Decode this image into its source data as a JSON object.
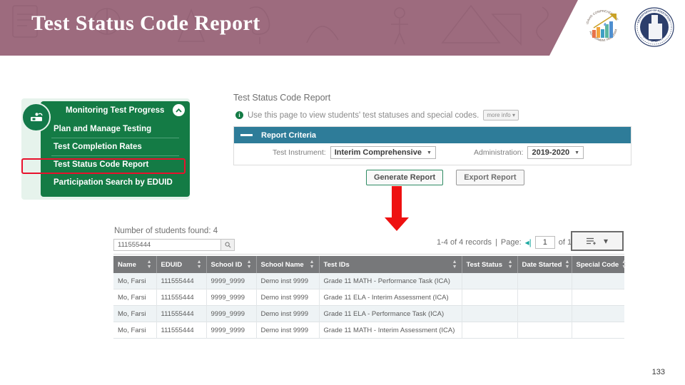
{
  "banner": {
    "title": "Test Status Code Report",
    "color": "#9d6b7e",
    "logos": [
      {
        "name": "idaho-comprehensive-assessment-program-logo",
        "text_top": "IDAHO COMPREHENSIVE",
        "text_bottom": "ASSESSMENT PROGRAM"
      },
      {
        "name": "idaho-department-of-education-seal",
        "text_top": "DEPARTMENT OF EDUCATION",
        "text_bottom": "STATE OF IDAHO"
      }
    ]
  },
  "sidebar": {
    "header": {
      "label": "Monitoring Test Progress",
      "icon": "monitor-progress-icon",
      "chevron": "chevron-up-icon"
    },
    "items": [
      {
        "label": "Plan and Manage Testing",
        "highlighted": false
      },
      {
        "label": "Test Completion Rates",
        "highlighted": false
      },
      {
        "label": "Test Status Code Report",
        "highlighted": true
      },
      {
        "label": "Participation Search by EDUID",
        "highlighted": false
      }
    ],
    "highlight_color": "#e8112d",
    "bg_color": "#147b45"
  },
  "report": {
    "title": "Test Status Code Report",
    "info_text": "Use this page to view students' test statuses and special codes.",
    "more_info_label": "more info",
    "criteria": {
      "header": "Report Criteria",
      "fields": [
        {
          "label": "Test Instrument:",
          "value": "Interim Comprehensive"
        },
        {
          "label": "Administration:",
          "value": "2019-2020"
        }
      ]
    },
    "buttons": [
      {
        "label": "Generate Report",
        "primary": true
      },
      {
        "label": "Export Report",
        "primary": false
      }
    ]
  },
  "results": {
    "found_label": "Number of students found: 4",
    "search_value": "111555444",
    "search_placeholder": "",
    "search_icon": "magnifier-icon",
    "pager": {
      "records_text": "1-4 of 4 records",
      "page_label": "Page:",
      "page_value": "1",
      "of_text": "of 1",
      "first_icon": "first-page-icon",
      "last_icon": "last-page-icon",
      "menu_icon": "list-options-icon"
    },
    "columns": [
      {
        "label": "Name",
        "sortable": true
      },
      {
        "label": "EDUID",
        "sortable": true
      },
      {
        "label": "School ID",
        "sortable": true
      },
      {
        "label": "School Name",
        "sortable": true
      },
      {
        "label": "Test IDs",
        "sortable": true
      },
      {
        "label": "Test Status",
        "sortable": true
      },
      {
        "label": "Date Started",
        "sortable": true
      },
      {
        "label": "Special Code",
        "sortable": true
      }
    ],
    "rows": [
      {
        "name": "Mo, Farsi",
        "eduid": "111555444",
        "school_id": "9999_9999",
        "school_name": "Demo inst 9999",
        "test_ids": "Grade 11 MATH - Performance Task (ICA)",
        "test_status": "",
        "date_started": "",
        "special_code": ""
      },
      {
        "name": "Mo, Farsi",
        "eduid": "111555444",
        "school_id": "9999_9999",
        "school_name": "Demo inst 9999",
        "test_ids": "Grade 11 ELA - Interim Assessment (ICA)",
        "test_status": "",
        "date_started": "",
        "special_code": ""
      },
      {
        "name": "Mo, Farsi",
        "eduid": "111555444",
        "school_id": "9999_9999",
        "school_name": "Demo inst 9999",
        "test_ids": "Grade 11 ELA - Performance Task (ICA)",
        "test_status": "",
        "date_started": "",
        "special_code": ""
      },
      {
        "name": "Mo, Farsi",
        "eduid": "111555444",
        "school_id": "9999_9999",
        "school_name": "Demo inst 9999",
        "test_ids": "Grade 11 MATH - Interim Assessment (ICA)",
        "test_status": "",
        "date_started": "",
        "special_code": ""
      }
    ]
  },
  "annotation": {
    "arrow": "red-down-arrow",
    "color": "#ee1111"
  },
  "slide": {
    "page_number": "133"
  }
}
